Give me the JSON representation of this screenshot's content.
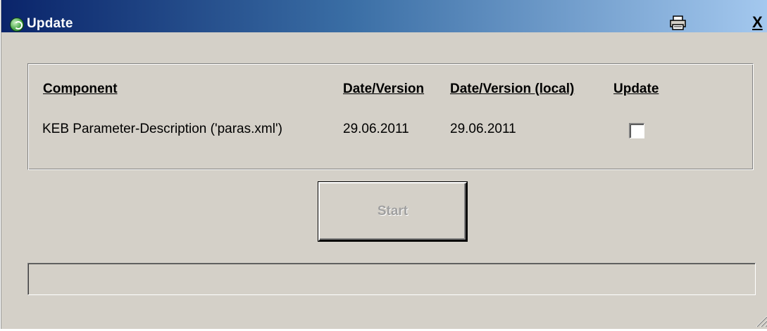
{
  "window": {
    "title": "Update",
    "close_label": "X"
  },
  "table": {
    "headers": {
      "component": "Component",
      "date_version": "Date/Version",
      "date_version_local": "Date/Version (local)",
      "update": "Update"
    },
    "rows": [
      {
        "component": "KEB  Parameter-Description  ('paras.xml')",
        "date_version": "29.06.2011",
        "date_version_local": "29.06.2011",
        "update_checked": false
      }
    ]
  },
  "buttons": {
    "start": "Start",
    "start_enabled": false
  },
  "progress": {
    "value": 0
  },
  "icons": {
    "app": "update-globe-icon",
    "print": "printer-icon",
    "grip": "resize-grip-icon"
  },
  "colors": {
    "titlebar_start": "#0a246a",
    "titlebar_end": "#a6caf0",
    "window_face": "#d4d0c8",
    "disabled_text": "#a0a0a0"
  }
}
